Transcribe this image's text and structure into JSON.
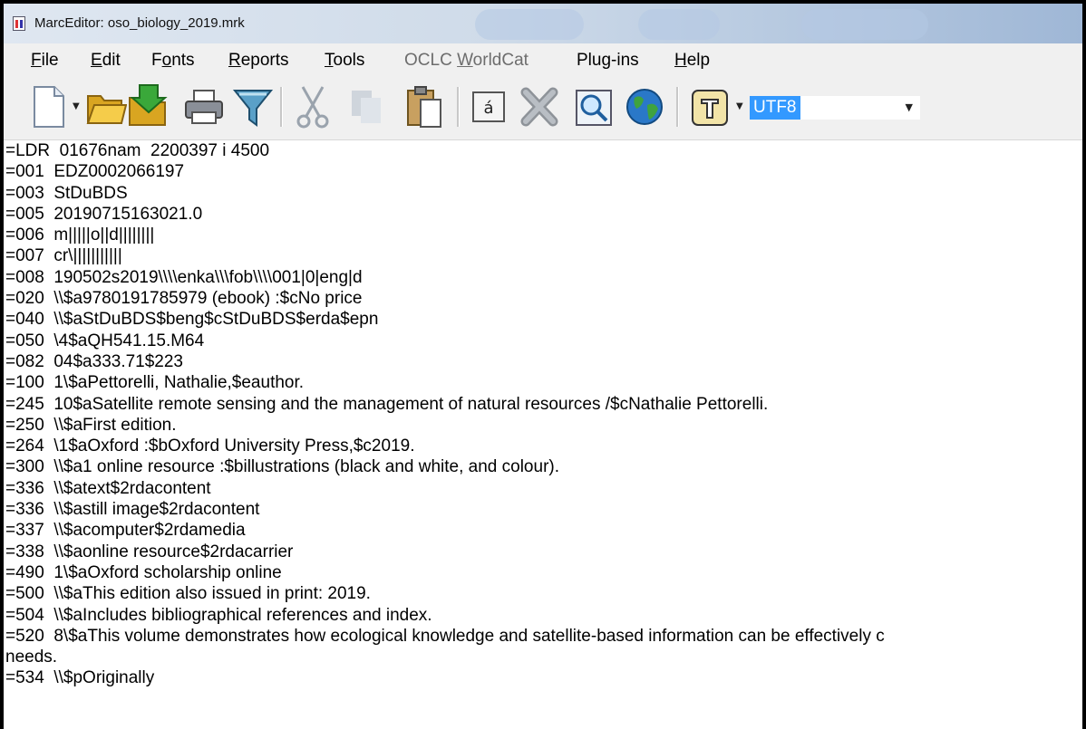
{
  "window": {
    "title": "MarcEditor: oso_biology_2019.mrk"
  },
  "menu": [
    {
      "label_pre": "",
      "accel": "F",
      "label_post": "ile",
      "enabled": true
    },
    {
      "label_pre": "",
      "accel": "E",
      "label_post": "dit",
      "enabled": true
    },
    {
      "label_pre": "F",
      "accel": "o",
      "label_post": "nts",
      "enabled": true
    },
    {
      "label_pre": "",
      "accel": "R",
      "label_post": "eports",
      "enabled": true
    },
    {
      "label_pre": "",
      "accel": "T",
      "label_post": "ools",
      "enabled": true
    },
    {
      "label_pre": "OCLC ",
      "accel": "W",
      "label_post": "orldCat",
      "enabled": false
    },
    {
      "label_pre": "Plug-ins",
      "accel": "",
      "label_post": "",
      "enabled": true
    },
    {
      "label_pre": "",
      "accel": "H",
      "label_post": "elp",
      "enabled": true
    }
  ],
  "toolbar": {
    "icons": [
      "new-document-icon",
      "open-folder-icon",
      "save-icon",
      "print-icon",
      "filter-icon",
      "cut-icon",
      "copy-icon",
      "paste-icon",
      "character-icon",
      "delete-icon",
      "find-icon",
      "globe-icon",
      "validate-icon"
    ],
    "character_glyph": "á",
    "encoding": "UTF8"
  },
  "record": {
    "lines": [
      "=LDR  01676nam  2200397 i 4500",
      "=001  EDZ0002066197",
      "=003  StDuBDS",
      "=005  20190715163021.0",
      "=006  m|||||o||d||||||||",
      "=007  cr\\|||||||||||",
      "=008  190502s2019\\\\\\\\enka\\\\\\fob\\\\\\\\001|0|eng|d",
      "=020  \\\\$a9780191785979 (ebook) :$cNo price",
      "=040  \\\\$aStDuBDS$beng$cStDuBDS$erda$epn",
      "=050  \\4$aQH541.15.M64",
      "=082  04$a333.71$223",
      "=100  1\\$aPettorelli, Nathalie,$eauthor.",
      "=245  10$aSatellite remote sensing and the management of natural resources /$cNathalie Pettorelli.",
      "=250  \\\\$aFirst edition.",
      "=264  \\1$aOxford :$bOxford University Press,$c2019.",
      "=300  \\\\$a1 online resource :$billustrations (black and white, and colour).",
      "=336  \\\\$atext$2rdacontent",
      "=336  \\\\$astill image$2rdacontent",
      "=337  \\\\$acomputer$2rdamedia",
      "=338  \\\\$aonline resource$2rdacarrier",
      "=490  1\\$aOxford scholarship online",
      "=500  \\\\$aThis edition also issued in print: 2019.",
      "=504  \\\\$aIncludes bibliographical references and index.",
      "=520  8\\$aThis volume demonstrates how ecological knowledge and satellite-based information can be effectively c",
      "needs.",
      "=534  \\\\$pOriginally"
    ]
  }
}
